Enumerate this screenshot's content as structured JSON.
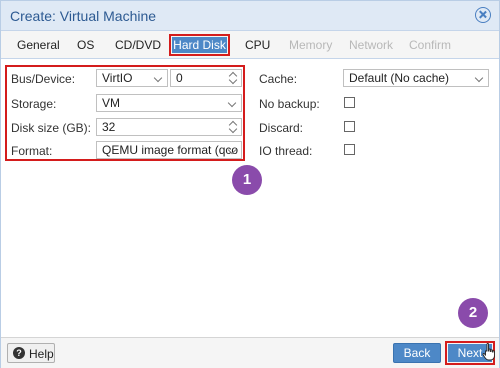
{
  "window": {
    "title": "Create: Virtual Machine"
  },
  "tabs": [
    {
      "label": "General",
      "state": "enabled"
    },
    {
      "label": "OS",
      "state": "enabled"
    },
    {
      "label": "CD/DVD",
      "state": "enabled"
    },
    {
      "label": "Hard Disk",
      "state": "active"
    },
    {
      "label": "CPU",
      "state": "enabled"
    },
    {
      "label": "Memory",
      "state": "disabled"
    },
    {
      "label": "Network",
      "state": "disabled"
    },
    {
      "label": "Confirm",
      "state": "disabled"
    }
  ],
  "form": {
    "bus_device": {
      "label": "Bus/Device:",
      "value": "VirtIO",
      "number": "0"
    },
    "storage": {
      "label": "Storage:",
      "value": "VM"
    },
    "disk_size": {
      "label": "Disk size (GB):",
      "value": "32"
    },
    "format": {
      "label": "Format:",
      "value": "QEMU image format (qco"
    },
    "cache": {
      "label": "Cache:",
      "value": "Default (No cache)"
    },
    "no_backup": {
      "label": "No backup:",
      "checked": false
    },
    "discard": {
      "label": "Discard:",
      "checked": false
    },
    "io_thread": {
      "label": "IO thread:",
      "checked": false
    }
  },
  "annotations": {
    "badge1": "1",
    "badge2": "2"
  },
  "footer": {
    "help": "Help",
    "help_icon": "?",
    "back": "Back",
    "next": "Next"
  },
  "colors": {
    "accent": "#4d88c7",
    "highlight": "#d41c1c",
    "badge": "#8a4bab",
    "titlebar": "#dfe9f5"
  },
  "icons": {
    "close": "close-icon",
    "help": "help-icon",
    "cursor": "hand-cursor-icon"
  }
}
